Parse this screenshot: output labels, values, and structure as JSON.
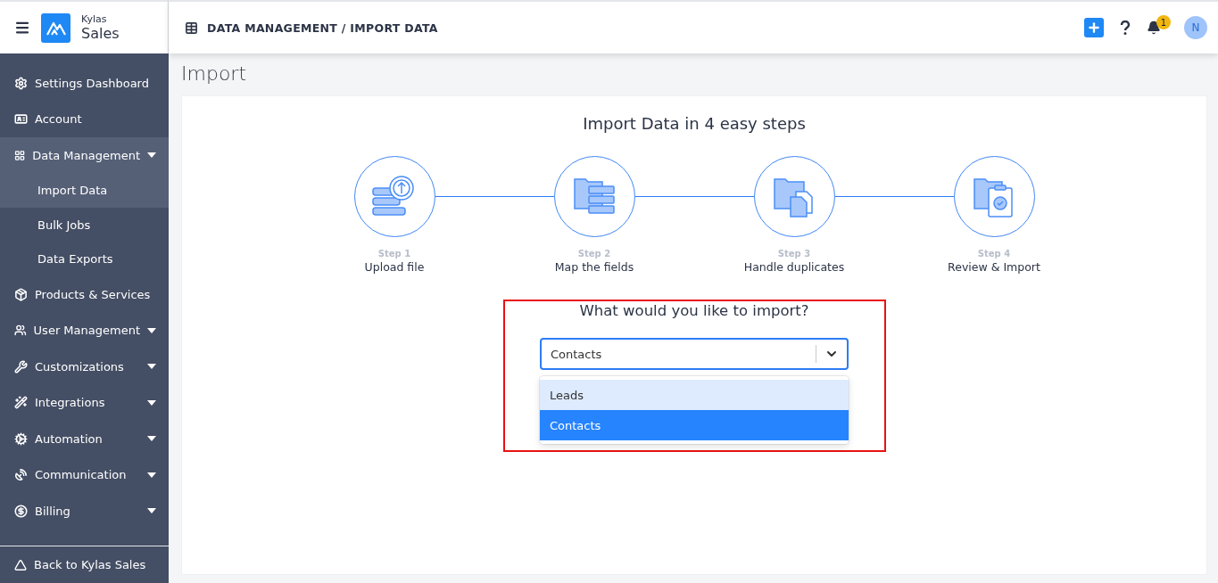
{
  "brand": {
    "small": "Kylas",
    "large": "Sales"
  },
  "breadcrumb": "DATA MANAGEMENT / IMPORT DATA",
  "notifications": {
    "count": "1"
  },
  "avatar": {
    "initial": "N"
  },
  "sidebar": {
    "items": [
      {
        "label": "Settings Dashboard",
        "dropdown": false,
        "expanded": false
      },
      {
        "label": "Account",
        "dropdown": false,
        "expanded": false
      },
      {
        "label": "Data Management",
        "dropdown": true,
        "expanded": true,
        "children": [
          {
            "label": "Import Data",
            "selected": true
          },
          {
            "label": "Bulk Jobs",
            "selected": false
          },
          {
            "label": "Data Exports",
            "selected": false
          }
        ]
      },
      {
        "label": "Products & Services",
        "dropdown": false,
        "expanded": false
      },
      {
        "label": "User Management",
        "dropdown": true,
        "expanded": false
      },
      {
        "label": "Customizations",
        "dropdown": true,
        "expanded": false
      },
      {
        "label": "Integrations",
        "dropdown": true,
        "expanded": false
      },
      {
        "label": "Automation",
        "dropdown": true,
        "expanded": false
      },
      {
        "label": "Communication",
        "dropdown": true,
        "expanded": false
      },
      {
        "label": "Billing",
        "dropdown": true,
        "expanded": false
      }
    ],
    "footer": "Back to Kylas Sales"
  },
  "page_title": "Import",
  "heading": "Import Data in 4 easy steps",
  "steps": [
    {
      "step": "Step 1",
      "label": "Upload file",
      "kind": "upload"
    },
    {
      "step": "Step 2",
      "label": "Map the fields",
      "kind": "map"
    },
    {
      "step": "Step 3",
      "label": "Handle duplicates",
      "kind": "duplicates"
    },
    {
      "step": "Step 4",
      "label": "Review & Import",
      "kind": "review"
    }
  ],
  "question": "What would you like to import?",
  "select": {
    "value": "Contacts",
    "options": [
      {
        "label": "Leads",
        "selected": false,
        "hovered": true
      },
      {
        "label": "Contacts",
        "selected": true,
        "hovered": false
      }
    ]
  }
}
